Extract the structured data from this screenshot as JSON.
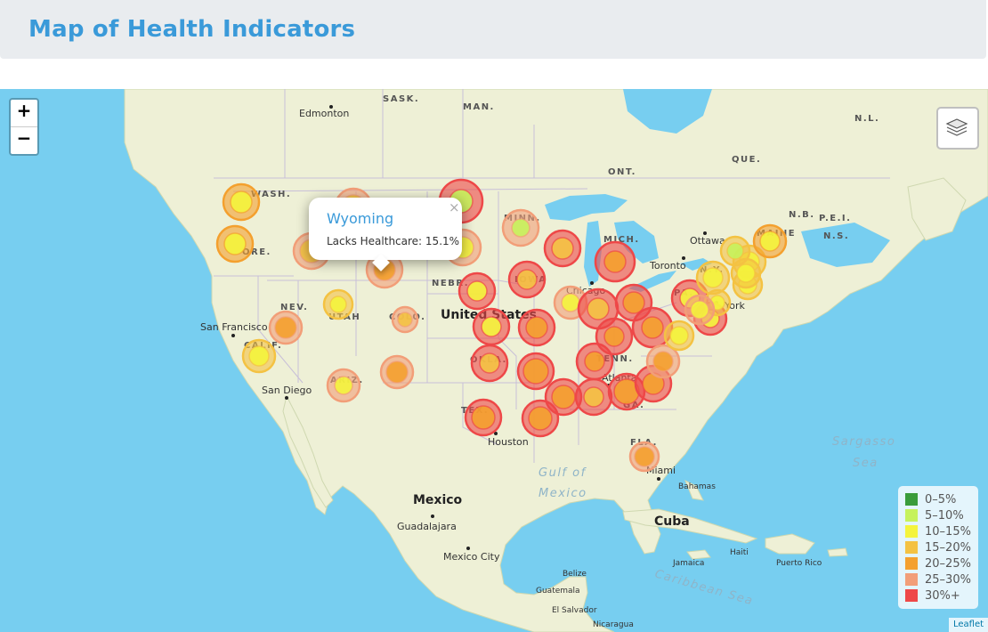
{
  "page": {
    "title": "Map of Health Indicators"
  },
  "map": {
    "zoom_in_label": "+",
    "zoom_out_label": "−",
    "attribution": "Leaflet",
    "place_labels": {
      "sask": "SASK.",
      "man": "MAN.",
      "ont": "ONT.",
      "que": "QUE.",
      "nl": "N.L.",
      "nb": "N.B.",
      "pei": "P.E.I.",
      "ns": "N.S.",
      "edmonton": "Edmonton",
      "ottawa": "Ottawa",
      "toronto": "Toronto",
      "chicago": "Chicago",
      "new_york": "York",
      "united_states": "United States",
      "san_francisco": "San Francisco",
      "san_diego": "San Diego",
      "houston": "Houston",
      "atlanta": "Atlanta",
      "miami": "Miami",
      "bahamas": "Bahamas",
      "mexico": "Mexico",
      "guadalajara": "Guadalajara",
      "mexico_city": "Mexico City",
      "cuba": "Cuba",
      "jamaica": "Jamaica",
      "haiti": "Haiti",
      "puerto_rico": "Puerto Rico",
      "belize": "Belize",
      "guatemala": "Guatemala",
      "el_salvador": "El Salvador",
      "nicaragua": "Nicaragua",
      "gulf_of": "Gulf of",
      "gulf_mexico": "Mexico",
      "sargasso": "Sargasso",
      "sea": "Sea",
      "caribbean": "Caribbean Sea",
      "wash": "WASH.",
      "ore": "ORE.",
      "calif": "CALIF.",
      "nev": "NEV.",
      "utah": "UTAH",
      "ariz": "ARIZ.",
      "colo": "COLO.",
      "nebr": "NEBR.",
      "iowa": "IOWA",
      "minn": "MINN.",
      "mich": "MICH.",
      "okla": "OKLA.",
      "tex": "TEX.",
      "tenn": "TENN.",
      "ga": "GA.",
      "fla": "FLA.",
      "pa": "PA.",
      "maine": "MAINE",
      "ny": "N.Y."
    }
  },
  "popup": {
    "title": "Wyoming",
    "text": "Lacks Healthcare: 15.1%",
    "close": "×"
  },
  "legend": [
    {
      "label": "0–5%",
      "color": "#3a9c3a"
    },
    {
      "label": "5–10%",
      "color": "#c6f25c"
    },
    {
      "label": "10–15%",
      "color": "#f4f43c"
    },
    {
      "label": "15–20%",
      "color": "#f4c242"
    },
    {
      "label": "20–25%",
      "color": "#f4a02e"
    },
    {
      "label": "25–30%",
      "color": "#f29e78"
    },
    {
      "label": "30%+",
      "color": "#ee4848"
    }
  ],
  "markers": [
    {
      "state": "Washington",
      "outer": "#f4a02e",
      "inner": "#f4f43c"
    },
    {
      "state": "Oregon",
      "outer": "#f4a02e",
      "inner": "#f4f43c"
    },
    {
      "state": "California",
      "outer": "#f4c242",
      "inner": "#f4f43c"
    },
    {
      "state": "Nevada",
      "outer": "#f29e78",
      "inner": "#f4a02e"
    },
    {
      "state": "Idaho",
      "outer": "#f29e78",
      "inner": "#f4c242"
    },
    {
      "state": "Montana",
      "outer": "#f29e78",
      "inner": "#f4c242"
    },
    {
      "state": "Wyoming",
      "outer": "#f29e78",
      "inner": "#f4a02e"
    },
    {
      "state": "Utah",
      "outer": "#f4c242",
      "inner": "#f4f43c"
    },
    {
      "state": "Arizona",
      "outer": "#f29e78",
      "inner": "#f4f43c"
    },
    {
      "state": "Colorado",
      "outer": "#f29e78",
      "inner": "#f4c242"
    },
    {
      "state": "New Mexico",
      "outer": "#f29e78",
      "inner": "#f4a02e"
    },
    {
      "state": "North Dakota",
      "outer": "#ee4848",
      "inner": "#c6f25c"
    },
    {
      "state": "South Dakota",
      "outer": "#f29e78",
      "inner": "#f4f43c"
    },
    {
      "state": "Nebraska",
      "outer": "#ee4848",
      "inner": "#f4f43c"
    },
    {
      "state": "Kansas",
      "outer": "#ee4848",
      "inner": "#f4f43c"
    },
    {
      "state": "Oklahoma",
      "outer": "#ee4848",
      "inner": "#f4c242"
    },
    {
      "state": "Texas",
      "outer": "#ee4848",
      "inner": "#f4a02e"
    },
    {
      "state": "Minnesota",
      "outer": "#f29e78",
      "inner": "#c6f25c"
    },
    {
      "state": "Iowa",
      "outer": "#ee4848",
      "inner": "#f4c242"
    },
    {
      "state": "Missouri",
      "outer": "#ee4848",
      "inner": "#f4a02e"
    },
    {
      "state": "Arkansas",
      "outer": "#ee4848",
      "inner": "#f4a02e"
    },
    {
      "state": "Louisiana",
      "outer": "#ee4848",
      "inner": "#f4a02e"
    },
    {
      "state": "Wisconsin",
      "outer": "#ee4848",
      "inner": "#f4c242"
    },
    {
      "state": "Illinois",
      "outer": "#f29e78",
      "inner": "#f4f43c"
    },
    {
      "state": "Mississippi",
      "outer": "#ee4848",
      "inner": "#f4a02e"
    },
    {
      "state": "Michigan",
      "outer": "#ee4848",
      "inner": "#f4a02e"
    },
    {
      "state": "Indiana",
      "outer": "#ee4848",
      "inner": "#f4c242"
    },
    {
      "state": "Kentucky",
      "outer": "#ee4848",
      "inner": "#f4a02e"
    },
    {
      "state": "Tennessee",
      "outer": "#ee4848",
      "inner": "#f4a02e"
    },
    {
      "state": "Alabama",
      "outer": "#ee4848",
      "inner": "#f4c242"
    },
    {
      "state": "Georgia",
      "outer": "#ee4848",
      "inner": "#f4a02e"
    },
    {
      "state": "Florida",
      "outer": "#f29e78",
      "inner": "#f4a02e"
    },
    {
      "state": "Ohio",
      "outer": "#ee4848",
      "inner": "#f4a02e"
    },
    {
      "state": "West Virginia",
      "outer": "#ee4848",
      "inner": "#f4a02e"
    },
    {
      "state": "South Carolina",
      "outer": "#ee4848",
      "inner": "#f4a02e"
    },
    {
      "state": "North Carolina",
      "outer": "#f29e78",
      "inner": "#f4a02e"
    },
    {
      "state": "Virginia",
      "outer": "#f4c242",
      "inner": "#f4f43c"
    },
    {
      "state": "Pennsylvania",
      "outer": "#ee4848",
      "inner": "#f4f43c"
    },
    {
      "state": "Maryland",
      "outer": "#ee4848",
      "inner": "#f4f43c"
    },
    {
      "state": "Delaware",
      "outer": "#f4c242",
      "inner": "#f4f43c"
    },
    {
      "state": "New Jersey",
      "outer": "#f29e78",
      "inner": "#f4f43c"
    },
    {
      "state": "New York",
      "outer": "#f4c242",
      "inner": "#f4f43c"
    },
    {
      "state": "Connecticut",
      "outer": "#f4c242",
      "inner": "#f4f43c"
    },
    {
      "state": "Massachusetts",
      "outer": "#f4c242",
      "inner": "#f4f43c"
    },
    {
      "state": "Vermont",
      "outer": "#f4c242",
      "inner": "#c6f25c"
    },
    {
      "state": "New Hampshire",
      "outer": "#f4c242",
      "inner": "#f4f43c"
    },
    {
      "state": "Maine",
      "outer": "#f4a02e",
      "inner": "#f4f43c"
    }
  ]
}
